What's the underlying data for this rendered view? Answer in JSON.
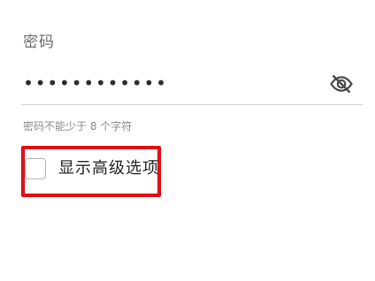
{
  "password_field": {
    "label": "密码",
    "value": "••••••••••••",
    "visibility_icon": "eye-off-icon",
    "helper_text": "密码不能少于 8 个字符"
  },
  "advanced_options": {
    "checkbox_label": "显示高级选项",
    "checked": false,
    "highlight_color": "#e40d16"
  }
}
